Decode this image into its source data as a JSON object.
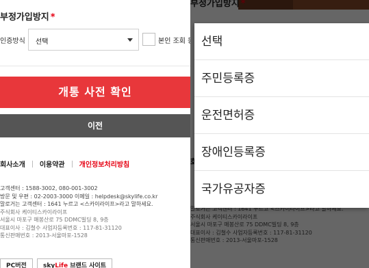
{
  "page": {
    "section_title": "부정가입방지",
    "required_mark": "*",
    "auth_method_label": "인증방식",
    "auth_select_value": "선택",
    "self_check_label": "본인 조회 동의",
    "primary_button": "개통 사전 확인",
    "prev_button": "이전"
  },
  "footer": {
    "links": [
      "회사소개",
      "이용약관",
      "개인정보처리방침"
    ],
    "info_lines": [
      "고객센터 : 1588-3002, 080-001-3002",
      "방문 및 우편 : 02-2003-3000    이메일 : helpdesk@skylife.co.kr",
      "말로거는 고객센터 : 1641 누르고 <스카이라이프>라고 말하세요.",
      "주식회사 케이티스카이라이프",
      "서울시 마포구 매봉산로 75 DDMC빌딩 8, 9층",
      "대표이사 : 김철수      사업자등록번호 : 117-81-31120",
      "통신판매번호 : 2013-서울마포-1528"
    ],
    "pc_button": "PC버전",
    "brand_prefix": "sky",
    "brand_mark": "Life",
    "brand_suffix": " 브랜드 사이트"
  },
  "dropdown": {
    "options": [
      "선택",
      "주민등록증",
      "운전면허증",
      "장애인등록증",
      "국가유공자증"
    ]
  },
  "colors": {
    "accent": "#e8373b",
    "secondary_button": "#555555",
    "overlay": "rgba(0,0,0,0.6)"
  }
}
